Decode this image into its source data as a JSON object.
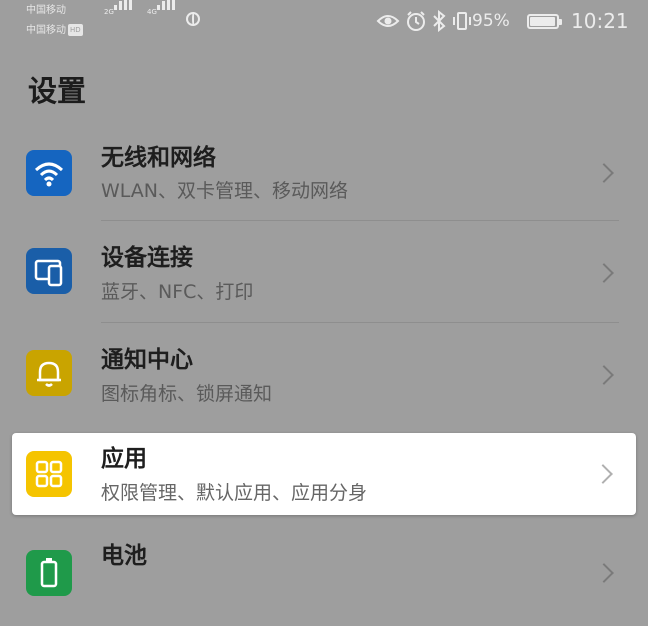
{
  "status_bar": {
    "carrier1": "中国移动",
    "carrier2": "中国移动",
    "hd_badge": "HD",
    "net1": "2G",
    "net2": "4G",
    "battery_percent": "95%",
    "time": "10:21",
    "icons": [
      "eye-icon",
      "alarm-icon",
      "bluetooth-icon",
      "vibrate-icon",
      "battery-icon",
      "globe-icon"
    ]
  },
  "page": {
    "title": "设置"
  },
  "settings_items": [
    {
      "title": "无线和网络",
      "subtitle": "WLAN、双卡管理、移动网络",
      "icon": "wifi-icon",
      "icon_color": "#1565c0"
    },
    {
      "title": "设备连接",
      "subtitle": "蓝牙、NFC、打印",
      "icon": "device-connection-icon",
      "icon_color": "#1a5ea8"
    },
    {
      "title": "通知中心",
      "subtitle": "图标角标、锁屏通知",
      "icon": "bell-icon",
      "icon_color": "#c9a400"
    },
    {
      "title": "应用",
      "subtitle": "权限管理、默认应用、应用分身",
      "icon": "apps-grid-icon",
      "icon_color": "#f5c400"
    },
    {
      "title": "电池",
      "subtitle": "",
      "icon": "battery-setting-icon",
      "icon_color": "#1f9a4a"
    }
  ],
  "colors": {
    "background_dim": "#9e9e9e",
    "highlight": "#ffffff"
  }
}
